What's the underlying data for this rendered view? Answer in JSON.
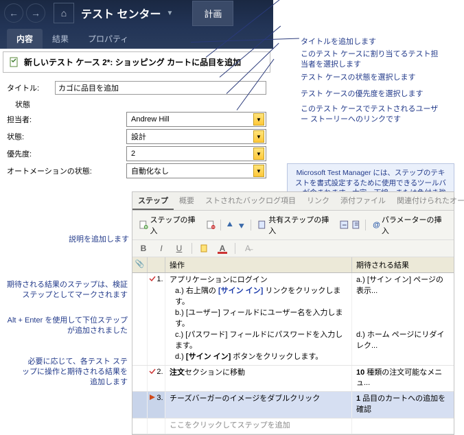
{
  "topbar": {
    "app_title": "テスト センター",
    "plan_tab": "計画"
  },
  "subtabs": {
    "content": "内容",
    "results": "結果",
    "properties": "プロパティ"
  },
  "case": {
    "heading": "新しいテスト ケース 2*: ショッピング カートに品目を追加"
  },
  "form": {
    "title_label": "タイトル:",
    "title_value": "カゴに品目を追加",
    "state_heading": "状態",
    "assignee_label": "担当者:",
    "assignee_value": "Andrew Hill",
    "status_label": "状態:",
    "status_value": "設計",
    "priority_label": "優先度:",
    "priority_value": "2",
    "automation_label": "オートメーションの状態:",
    "automation_value": "自動化なし"
  },
  "callouts": {
    "c1": "タイトルを追加します",
    "c2": "このテスト ケースに割り当てるテスト担当者を選択します",
    "c3": "テスト ケースの状態を選択します",
    "c4": "テスト ケースの優先度を選択します",
    "c5": "このテスト ケースでテストされるユーザー ストーリーへのリンクです",
    "info": "Microsoft Test Manager には、ステップのテキストを書式設定するために使用できるツールバーが含まれます。太字、下線、または色付き強調表示など、さまざまな書式設定オプションを使用して、コメントのキー ポイントを強調できます。",
    "left_desc": "説明を追加します",
    "left_expected": "期待される結果のステップは、検証ステップとしてマークされます",
    "left_alt": "Alt + Enter を使用して下位ステップが追加されました",
    "left_bottom": "必要に応じて、各テスト ステップに操作と期待される結果を追加します"
  },
  "steps": {
    "tabs": {
      "steps": "ステップ",
      "summary": "概要",
      "backlog": "ストされたバックログ項目",
      "links": "リンク",
      "attach": "添付ファイル",
      "auto": "関連付けられたオートメーシ..."
    },
    "toolbar": {
      "insert_step": "ステップの挿入",
      "insert_shared": "共有ステップの挿入",
      "insert_param": "パラメーターの挿入"
    },
    "header": {
      "action": "操作",
      "result": "期待される結果"
    },
    "rows": [
      {
        "num": "1.",
        "action_main": "アプリケーションにログイン",
        "subs": [
          "a.) 右上隅の [サイン イン] リンクをクリックします。",
          "b.) [ユーザー] フィールドにユーザー名を入力します。",
          "c.) [パスワード] フィールドにパスワードを入力します。",
          "d.) [サイン イン] ボタンをクリックします。"
        ],
        "result_a": "a.) [サイン イン] ページの表示...",
        "result_d": "d.) ホーム ページにリダイレク..."
      },
      {
        "num": "2.",
        "action_main": "注文セクションに移動",
        "result": "10 種類の注文可能なメニュ..."
      },
      {
        "num": "3.",
        "action_main": "チーズバーガーのイメージをダブルクリック",
        "result": "1 品目のカートへの追加を確認"
      }
    ],
    "placeholder": "ここをクリックしてステップを追加"
  }
}
